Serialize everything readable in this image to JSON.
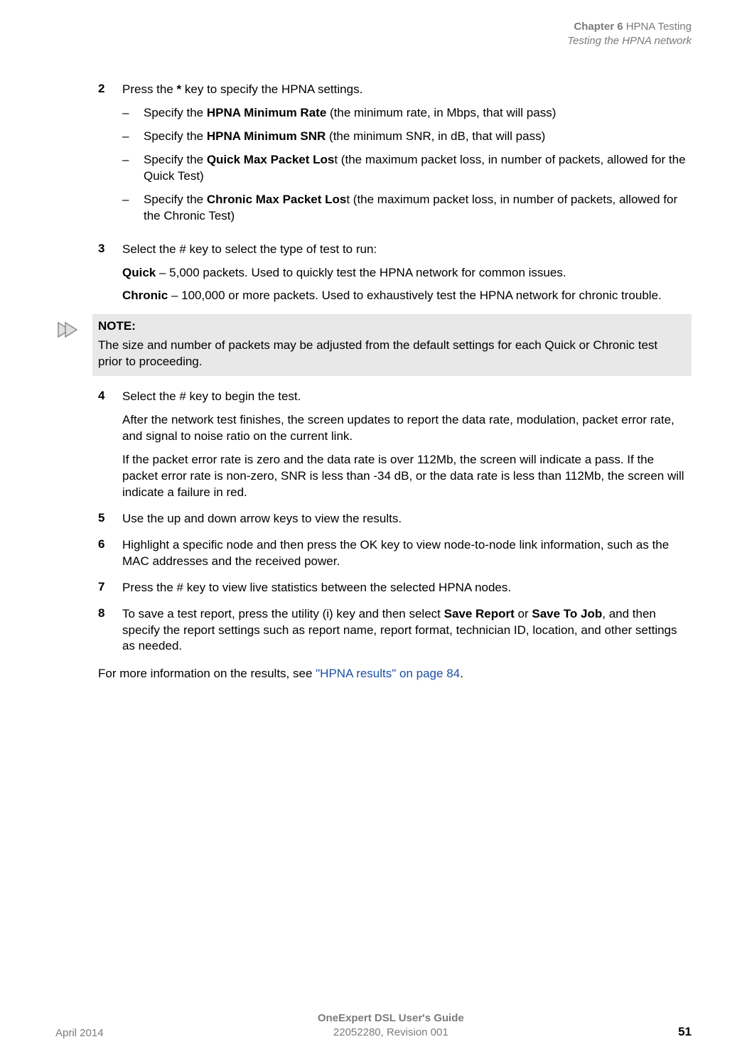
{
  "header": {
    "chapter_prefix": "Chapter 6",
    "chapter_title": "HPNA Testing",
    "section": "Testing the HPNA network"
  },
  "steps": {
    "s2": {
      "num": "2",
      "intro_a": "Press the ",
      "intro_b": "*",
      "intro_c": " key to specify the HPNA settings.",
      "sub1_a": "Specify the ",
      "sub1_b": "HPNA Minimum Rate",
      "sub1_c": " (the minimum rate, in Mbps, that will pass)",
      "sub2_a": "Specify the ",
      "sub2_b": "HPNA Minimum SNR",
      "sub2_c": " (the minimum SNR, in dB, that will pass)",
      "sub3_a": "Specify the ",
      "sub3_b": "Quick Max Packet Los",
      "sub3_c": "t (the maximum packet loss, in number of packets, allowed for the Quick Test)",
      "sub4_a": "Specify the ",
      "sub4_b": "Chronic Max Packet Los",
      "sub4_c": "t (the maximum packet loss, in number of packets, allowed for the Chronic Test)"
    },
    "s3": {
      "num": "3",
      "intro": "Select the # key to select the type of test to run:",
      "quick_b": "Quick",
      "quick_t": " – 5,000 packets. Used to quickly test the HPNA network for common issues.",
      "chronic_b": "Chronic",
      "chronic_t": " – 100,000 or more packets. Used to exhaustively test the HPNA network for chronic trouble."
    },
    "s4": {
      "num": "4",
      "p1": "Select the # key to begin the test.",
      "p2": "After the network test finishes, the screen updates to report the data rate, modulation, packet error rate, and signal to noise ratio on the current link.",
      "p3": "If the packet error rate is zero and the data rate is over 112Mb, the screen will indicate a pass. If the packet error rate is non-zero, SNR is less than -34 dB, or the data rate is less than 112Mb, the screen will indicate a failure in red."
    },
    "s5": {
      "num": "5",
      "p1": "Use the up and down arrow keys to view the results."
    },
    "s6": {
      "num": "6",
      "p1": "Highlight a specific node and then press the OK key to view node-to-node link information, such as the MAC addresses and the received power."
    },
    "s7": {
      "num": "7",
      "p1": "Press the # key to view live statistics between the selected HPNA nodes."
    },
    "s8": {
      "num": "8",
      "p1_a": "To save a test report, press the utility (i) key and then select ",
      "p1_b": "Save Report",
      "p1_c": " or ",
      "p1_d": "Save To Job",
      "p1_e": ", and then specify the report settings such as report name, report format, technician ID, location, and other settings as needed."
    }
  },
  "note": {
    "title": "NOTE:",
    "body": "The size and number of packets may be adjusted from the default settings for each Quick or Chronic test prior to proceeding."
  },
  "closing": {
    "pre": "For more information on the results, see ",
    "link": "\"HPNA results\" on page 84",
    "post": "."
  },
  "footer": {
    "left": "April 2014",
    "center1": "OneExpert DSL User's Guide",
    "center2": "22052280, Revision 001",
    "right": "51"
  },
  "dash": "–"
}
